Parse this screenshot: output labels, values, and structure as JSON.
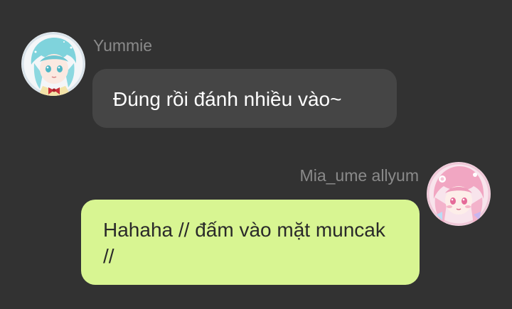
{
  "chat": {
    "messages": [
      {
        "sender": "Yummie",
        "text": "Đúng rồi đánh nhiều vào~",
        "side": "left",
        "avatar": "avatar-yummie-teal-hair",
        "bubble_color": "#454545"
      },
      {
        "sender": "Mia_ume allyum",
        "text": "Hahaha // đấm vào mặt muncak //",
        "side": "right",
        "avatar": "avatar-mia-pink-hair",
        "bubble_color": "#d8f592"
      }
    ],
    "background_color": "#323232",
    "name_color": "#8a8a8a"
  }
}
